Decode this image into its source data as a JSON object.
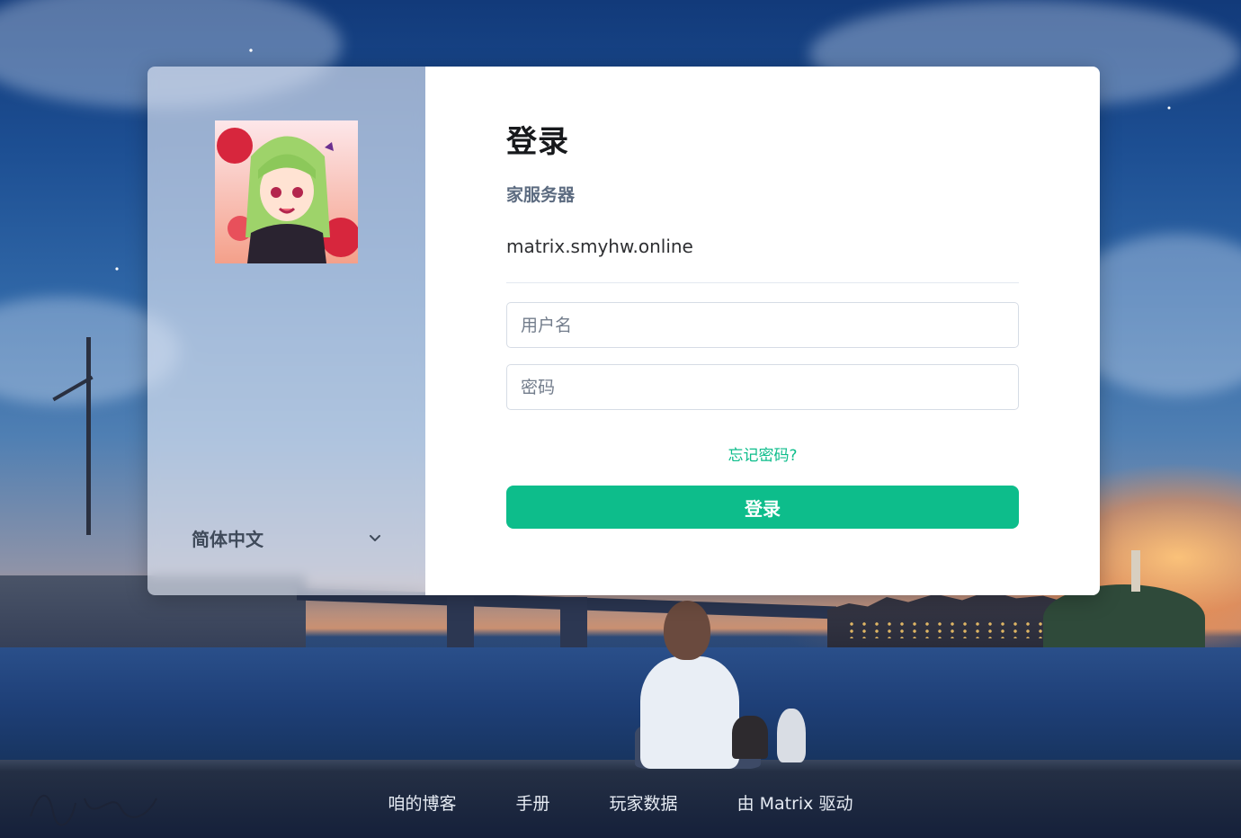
{
  "login": {
    "title": "登录",
    "homeserver_label": "家服务器",
    "homeserver_value": "matrix.smyhw.online",
    "username_placeholder": "用户名",
    "password_placeholder": "密码",
    "forgot_label": "忘记密码?",
    "submit_label": "登录"
  },
  "sidebar": {
    "language": "简体中文",
    "language_icon": "chevron-down-icon"
  },
  "footer": {
    "links": [
      "咱的博客",
      "手册",
      "玩家数据",
      "由 Matrix 驱动"
    ]
  },
  "colors": {
    "accent": "#0dbd8b",
    "heading": "#17191c",
    "muted": "#5c6b80"
  }
}
